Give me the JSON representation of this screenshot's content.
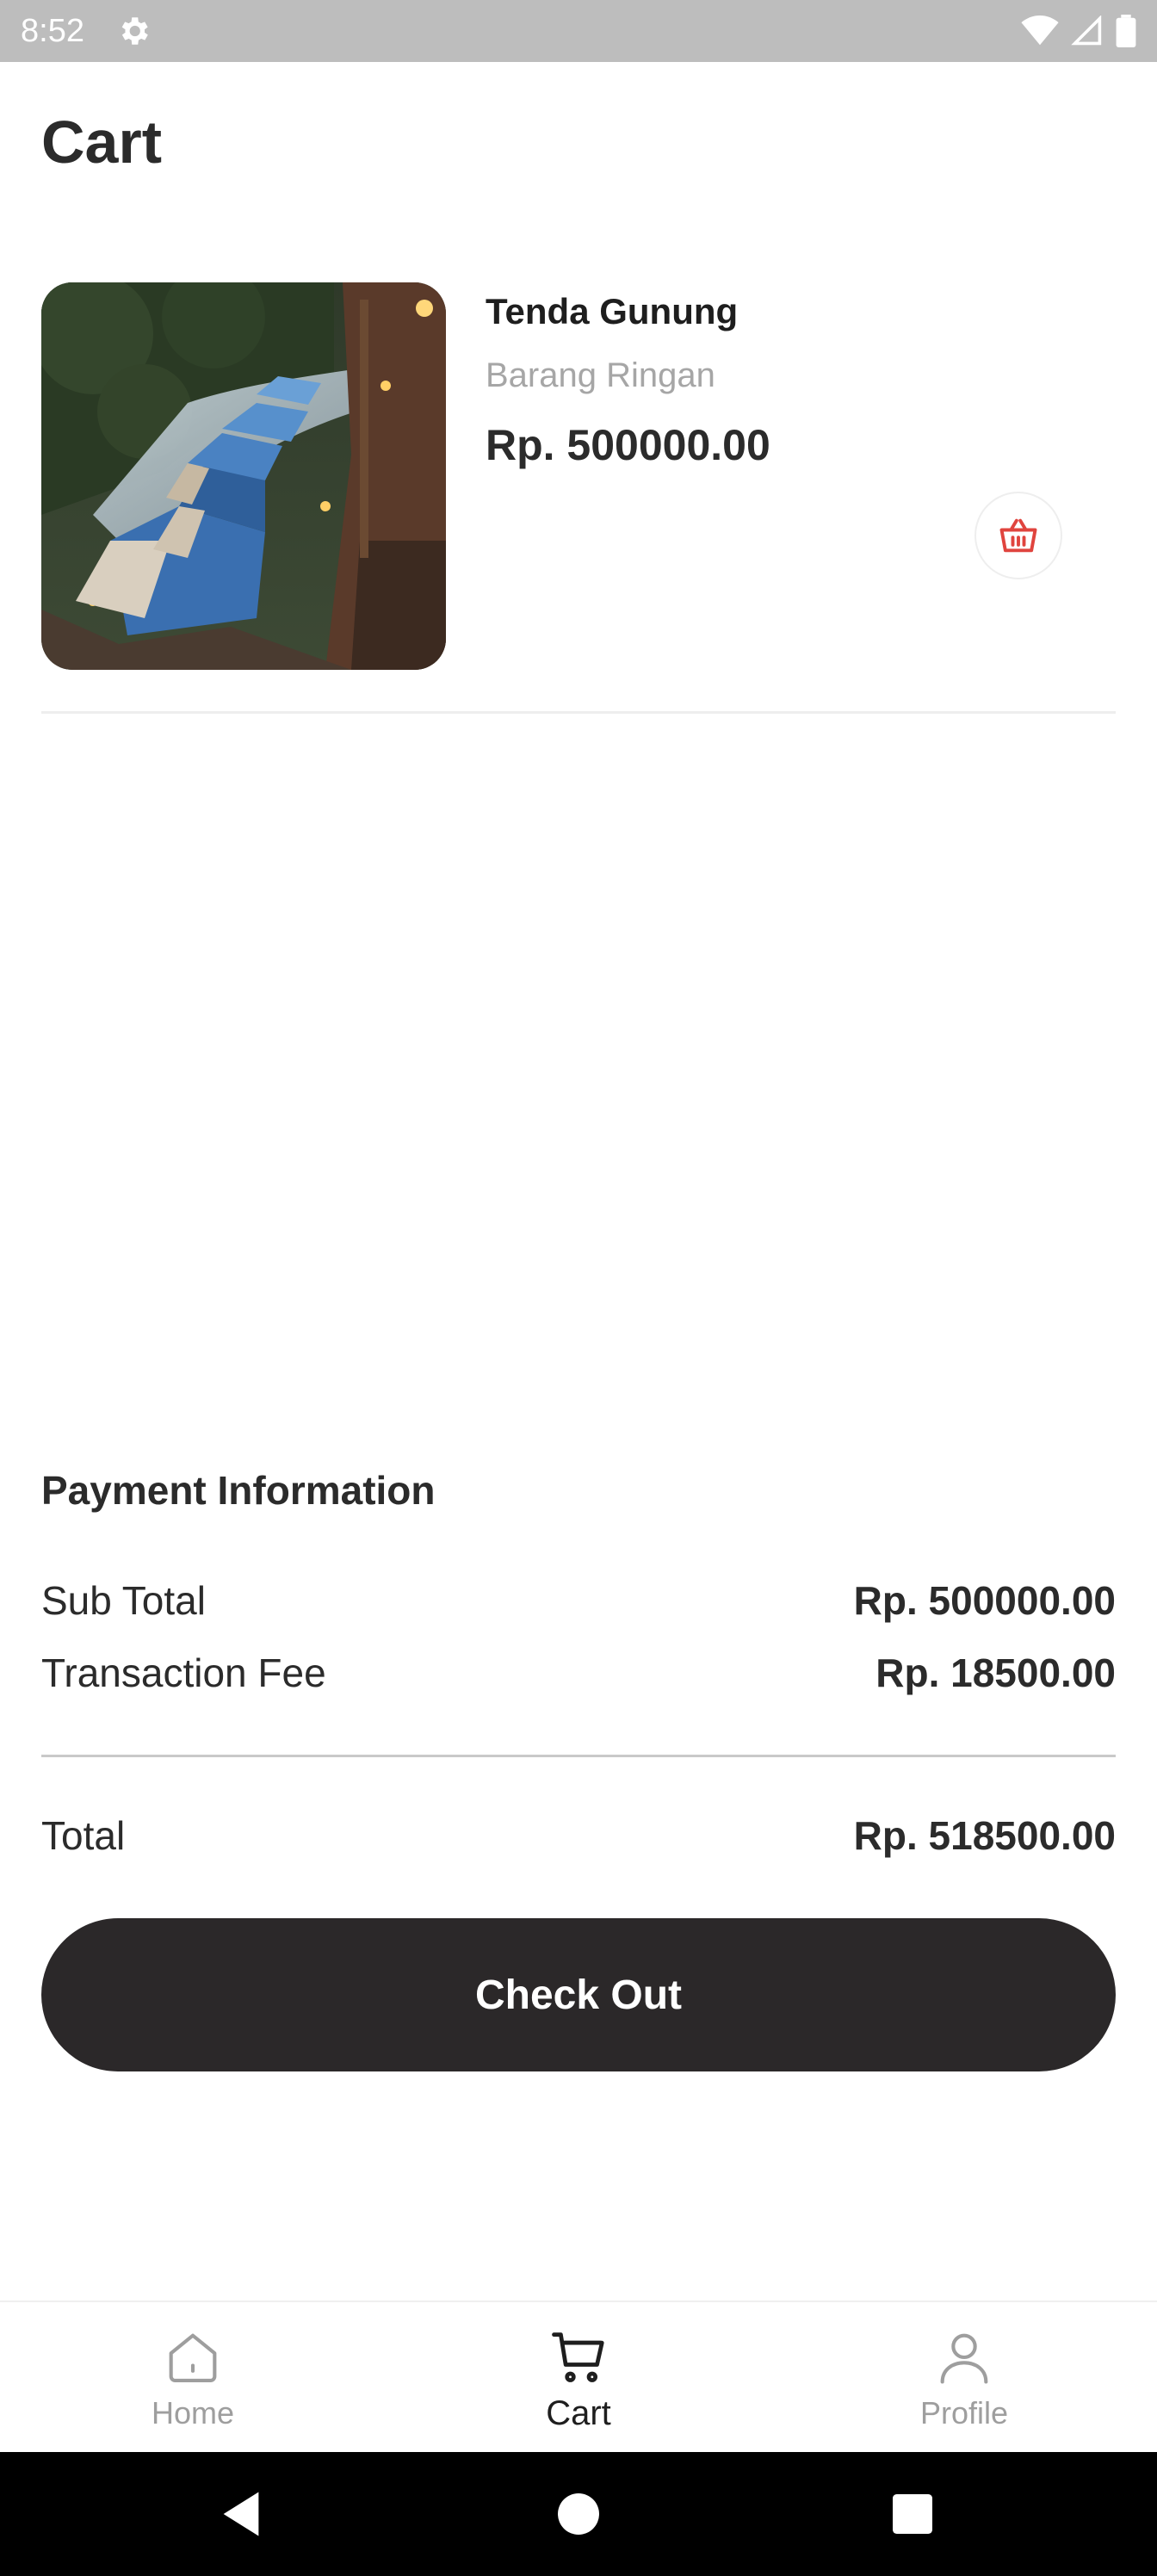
{
  "status_bar": {
    "time": "8:52"
  },
  "header": {
    "title": "Cart"
  },
  "cart_items": [
    {
      "name": "Tenda Gunung",
      "category": "Barang Ringan",
      "price": "Rp. 500000.00"
    }
  ],
  "payment": {
    "heading": "Payment Information",
    "subtotal_label": "Sub Total",
    "subtotal_value": "Rp. 500000.00",
    "fee_label": "Transaction Fee",
    "fee_value": "Rp. 18500.00",
    "total_label": "Total",
    "total_value": "Rp. 518500.00"
  },
  "checkout": {
    "label": "Check Out"
  },
  "bottom_nav": {
    "items": [
      {
        "label": "Home",
        "icon": "home-icon",
        "active": false
      },
      {
        "label": "Cart",
        "icon": "cart-icon",
        "active": true
      },
      {
        "label": "Profile",
        "icon": "profile-icon",
        "active": false
      }
    ]
  },
  "colors": {
    "accent_dark": "#2b2829",
    "remove_icon": "#e0443e",
    "muted_text": "#a6a6a6"
  }
}
